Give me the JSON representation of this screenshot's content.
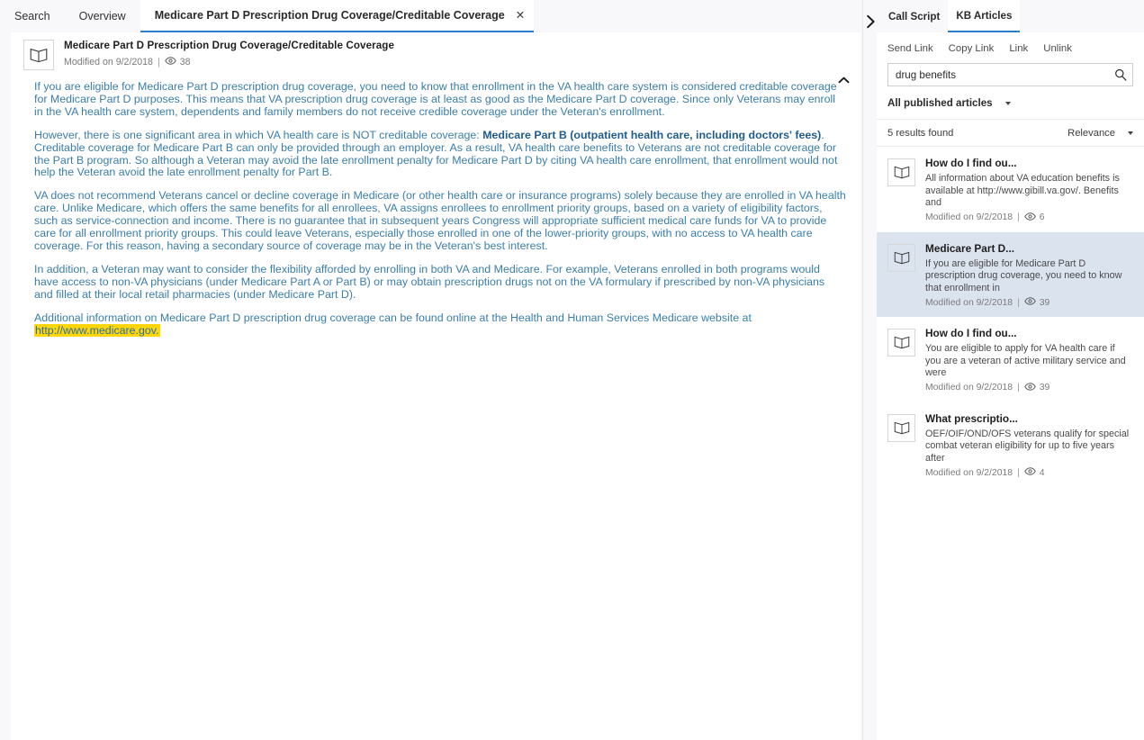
{
  "tabs": [
    {
      "label": "Search",
      "active": false,
      "closable": false
    },
    {
      "label": "Overview",
      "active": false,
      "closable": false
    },
    {
      "label": "Medicare Part D Prescription Drug Coverage/Creditable Coverage",
      "active": true,
      "closable": true,
      "close_glyph": "✕"
    }
  ],
  "article": {
    "icon": "book-icon",
    "title": "Medicare Part D Prescription Drug Coverage/Creditable Coverage",
    "modified_label": "Modified on 9/2/2018",
    "separator": "|",
    "views_icon": "eye-icon",
    "views": "38",
    "collapse_icon": "chevron-up-icon",
    "paragraphs": [
      {
        "id": "p1",
        "runs": [
          {
            "text": "If you are eligible for Medicare Part D prescription drug coverage, you need to know that enrollment in the VA health care system is considered creditable coverage for Medicare Part D purposes. This means that VA prescription drug coverage is at least as good as the Medicare Part D coverage. Since only Veterans may enroll in the VA health care system, dependents and family members do not receive credible coverage under the Veteran's enrollment.",
            "style": "normal"
          }
        ]
      },
      {
        "id": "p2",
        "runs": [
          {
            "text": "However, there is one significant area in which VA health care is NOT creditable coverage: ",
            "style": "normal"
          },
          {
            "text": "Medicare Part B (outpatient health care, including doctors' fees)",
            "style": "bold"
          },
          {
            "text": ". Creditable coverage for Medicare Part B can only be provided through an employer. As a result, VA health care benefits to Veterans are not creditable coverage for the Part B program. So although a Veteran may avoid the late enrollment penalty for Medicare Part D by citing VA health care enrollment, that enrollment would not help the Veteran avoid the late enrollment penalty for Part B.",
            "style": "normal"
          }
        ]
      },
      {
        "id": "p3",
        "runs": [
          {
            "text": "VA does not recommend Veterans cancel or decline coverage in Medicare (or other health care or insurance programs) solely because they are enrolled in VA health care. Unlike Medicare, which offers the same benefits for all enrollees, VA assigns enrollees to enrollment priority groups, based on a variety of eligibility factors, such as service-connection and income. There is no guarantee that in subsequent years Congress will appropriate sufficient medical care funds for VA to provide care for all enrollment priority groups. This could leave Veterans, especially those enrolled in one of the lower-priority groups, with no access to VA health care coverage. For this reason, having a secondary source of coverage may be in the Veteran's best interest.",
            "style": "normal"
          }
        ]
      },
      {
        "id": "p4",
        "runs": [
          {
            "text": "In addition, a Veteran may want to consider the flexibility afforded by enrolling in both VA and Medicare. For example, Veterans enrolled in both programs would have access to non-VA physicians (under Medicare Part A or Part B) or may obtain prescription drugs not on the VA formulary if prescribed by non-VA physicians and filled at their local retail pharmacies (under Medicare Part D).",
            "style": "normal"
          }
        ]
      },
      {
        "id": "p5",
        "runs": [
          {
            "text": "Additional information on Medicare Part D prescription drug coverage can be found online at the Health and Human Services Medicare website at ",
            "style": "normal"
          },
          {
            "text": "http://www.medicare.gov.",
            "style": "highlight-link"
          }
        ]
      }
    ]
  },
  "kb_panel": {
    "expander_icon": "chevron-right-icon",
    "tabs": [
      {
        "label": "Call Script",
        "active": false
      },
      {
        "label": "KB Articles",
        "active": true
      }
    ],
    "actions": [
      {
        "label": "Send Link"
      },
      {
        "label": "Copy Link"
      },
      {
        "label": "Link"
      },
      {
        "label": "Unlink"
      }
    ],
    "search": {
      "value": "drug benefits",
      "placeholder": "Search",
      "icon": "search-icon"
    },
    "filter": {
      "label": "All published articles",
      "icon": "chevron-down-icon"
    },
    "results_header": {
      "count_label": "5 results found",
      "sort_label": "Relevance",
      "sort_icon": "chevron-down-icon"
    },
    "results": [
      {
        "icon": "book-icon",
        "title": "How do I find ou...",
        "snippet": "All information about VA education benefits is available at http://www.gibill.va.gov/.   Benefits and",
        "modified_label": "Modified on 9/2/2018",
        "separator": "|",
        "views_icon": "eye-icon",
        "views": "6",
        "selected": false
      },
      {
        "icon": "book-icon",
        "title": "Medicare Part D...",
        "snippet": "If you are eligible for Medicare Part D prescription drug coverage, you need to know that enrollment in",
        "modified_label": "Modified on 9/2/2018",
        "separator": "|",
        "views_icon": "eye-icon",
        "views": "39",
        "selected": true
      },
      {
        "icon": "book-icon",
        "title": "How do I find ou...",
        "snippet": "You are eligible to apply for VA health care if you are a veteran of active military service and were",
        "modified_label": "Modified on 9/2/2018",
        "separator": "|",
        "views_icon": "eye-icon",
        "views": "39",
        "selected": false
      },
      {
        "icon": "book-icon",
        "title": "What prescriptio...",
        "snippet": "OEF/OIF/OND/OFS veterans qualify for special combat veteran eligibility for up to five years after",
        "modified_label": "Modified on 9/2/2018",
        "separator": "|",
        "views_icon": "eye-icon",
        "views": "4",
        "selected": false
      }
    ]
  },
  "colors": {
    "accent": "#2a7fc9",
    "body_text": "#3b7eaa",
    "highlight": "#ffd60a",
    "selected_row": "#dbe3ef",
    "app_bg": "#f8f7fa"
  }
}
